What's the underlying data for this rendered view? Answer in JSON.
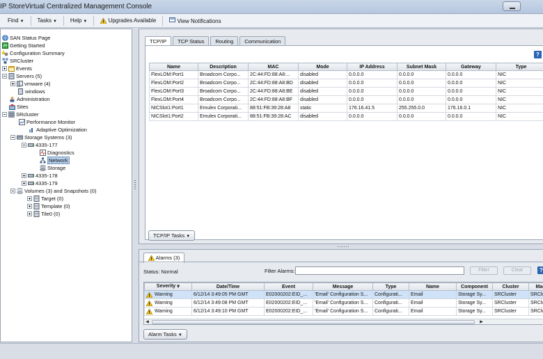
{
  "window": {
    "title": "IP StoreVirtual Centralized Management Console"
  },
  "menubar": {
    "items": [
      {
        "label": "Find",
        "has_arrow": true
      },
      {
        "label": "Tasks",
        "has_arrow": true
      },
      {
        "label": "Help",
        "has_arrow": true
      }
    ],
    "upgrades_label": "Upgrades Available",
    "notifications_label": "View Notifications"
  },
  "tree": {
    "items": [
      {
        "label": "SAN Status Page",
        "icon": "globe-icon"
      },
      {
        "label": "Getting Started",
        "icon": "green-flag-icon"
      },
      {
        "label": "Configuration Summary",
        "icon": "warning-config-icon"
      },
      {
        "label": "SRCluster",
        "icon": "management-group-icon"
      },
      {
        "label": "Events",
        "icon": "events-icon"
      },
      {
        "label": "Servers (5)",
        "icon": "servers-icon"
      },
      {
        "label": "vmware (4)",
        "icon": "server-cluster-icon"
      },
      {
        "label": "windows",
        "icon": "server-icon"
      },
      {
        "label": "Administration",
        "icon": "admin-icon"
      },
      {
        "label": "Sites",
        "icon": "sites-icon"
      },
      {
        "label": "SRcluster",
        "icon": "cluster-icon"
      },
      {
        "label": "Performance Monitor",
        "icon": "performance-icon"
      },
      {
        "label": "Adaptive Optimization",
        "icon": "optimization-icon"
      },
      {
        "label": "Storage Systems (3)",
        "icon": "storage-systems-icon"
      },
      {
        "label": "4335-177",
        "icon": "storage-node-icon"
      },
      {
        "label": "Diagnostics",
        "icon": "diagnostics-icon"
      },
      {
        "label": "Network",
        "icon": "network-icon"
      },
      {
        "label": "Storage",
        "icon": "storage-icon"
      },
      {
        "label": "4335-178",
        "icon": "storage-node-icon"
      },
      {
        "label": "4335-179",
        "icon": "storage-node-icon"
      },
      {
        "label": "Volumes (3) and Snapshots (0)",
        "icon": "volumes-icon"
      },
      {
        "label": "Target (0)",
        "icon": "volume-icon"
      },
      {
        "label": "Template (0)",
        "icon": "volume-icon"
      },
      {
        "label": "Tile0 (0)",
        "icon": "volume-icon"
      }
    ]
  },
  "tabs": [
    "TCP/IP",
    "TCP Status",
    "Routing",
    "Communication"
  ],
  "active_tab": "TCP/IP",
  "network_table": {
    "columns": [
      "Name",
      "Description",
      "MAC",
      "Mode",
      "IP Address",
      "Subnet Mask",
      "Gateway",
      "Type"
    ],
    "rows": [
      [
        "FlexLOM:Port1",
        "Broadcom Corpo...",
        "2C:44:FD:88:A8:...",
        "disabled",
        "0.0.0.0",
        "0.0.0.0",
        "0.0.0.0",
        "NIC"
      ],
      [
        "FlexLOM:Port2",
        "Broadcom Corpo...",
        "2C:44:FD:88:A8:BD",
        "disabled",
        "0.0.0.0",
        "0.0.0.0",
        "0.0.0.0",
        "NIC"
      ],
      [
        "FlexLOM:Port3",
        "Broadcom Corpo...",
        "2C:44:FD:88:A8:BE",
        "disabled",
        "0.0.0.0",
        "0.0.0.0",
        "0.0.0.0",
        "NIC"
      ],
      [
        "FlexLOM:Port4",
        "Broadcom Corpo...",
        "2C:44:FD:88:A8:BF",
        "disabled",
        "0.0.0.0",
        "0.0.0.0",
        "0.0.0.0",
        "NIC"
      ],
      [
        "NICSlot1:Port1",
        "Emulex Corporati...",
        "88:51:FB:39:28:A8",
        "static",
        "176.16.41.5",
        "255.255.0.0",
        "176.16.0.1",
        "NIC"
      ],
      [
        "NICSlot1:Port2",
        "Emulex Corporati...",
        "88:51:FB:39:28:AC",
        "disabled",
        "0.0.0.0",
        "0.0.0.0",
        "0.0.0.0",
        "NIC"
      ]
    ]
  },
  "tcpip_tasks_label": "TCP/IP Tasks",
  "alarms": {
    "tab_label": "Alarms (3)",
    "status_label": "Status:",
    "status_value": "Normal",
    "filter_label": "Filter Alarms:",
    "filter_value": "",
    "filter_button": "Filter",
    "clear_button": "Clear",
    "columns": [
      "Severity",
      "Date/Time",
      "Event",
      "Message",
      "Type",
      "Name",
      "Component",
      "Cluster",
      "Mana"
    ],
    "rows": [
      [
        "Warning",
        "6/12/14 3:49:05 PM GMT",
        "E02000202:EID_...",
        "'Email' Configuration S...",
        "Configurati...",
        "Email",
        "Storage Sy...",
        "SRCluster",
        "SRClu"
      ],
      [
        "Warning",
        "6/12/14 3:49:08 PM GMT",
        "E02000202:EID_...",
        "'Email' Configuration S...",
        "Configurati...",
        "Email",
        "Storage Sy...",
        "SRCluster",
        "SRClu"
      ],
      [
        "Warning",
        "6/12/14 3:49:10 PM GMT",
        "E02000202:EID_...",
        "'Email' Configuration S...",
        "Configurati...",
        "Email",
        "Storage Sy...",
        "SRCluster",
        "SRClu"
      ]
    ],
    "tasks_label": "Alarm Tasks"
  },
  "colors": {
    "accent": "#2b63b5",
    "selection": "#b4cdea",
    "warning": "#f2c21b"
  }
}
